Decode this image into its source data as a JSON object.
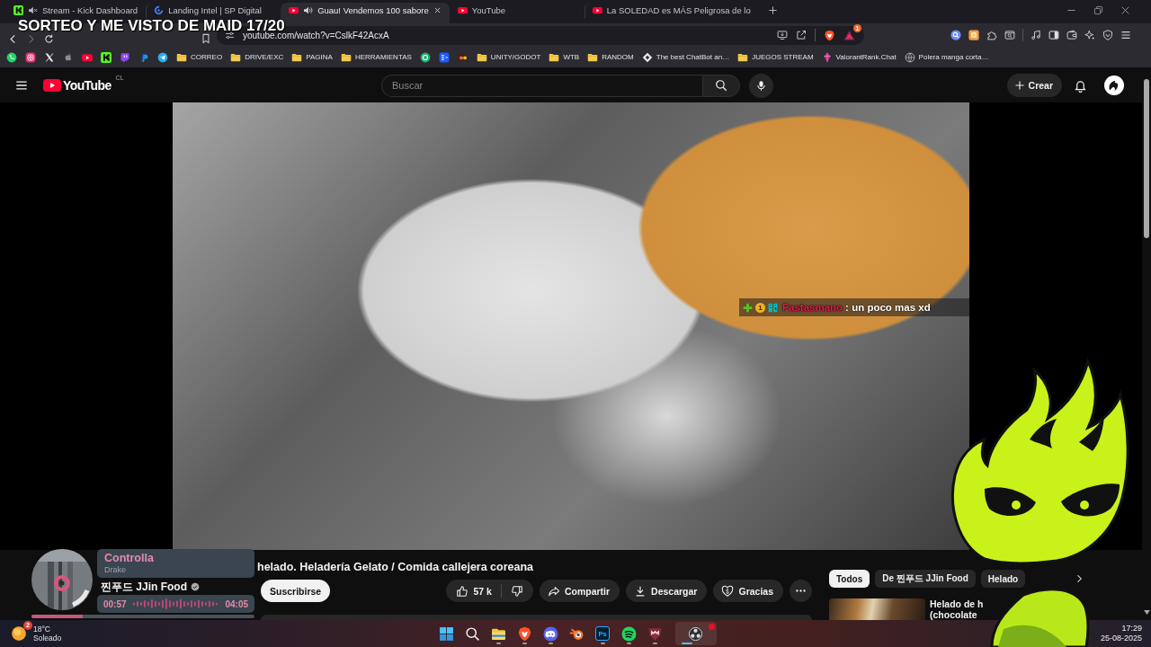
{
  "browser": {
    "tabs": [
      {
        "title": "Stream - Kick Dashboard",
        "selected": false,
        "muted": true,
        "playing": false
      },
      {
        "title": "Landing Intel | SP Digital",
        "selected": false,
        "muted": false,
        "playing": false
      },
      {
        "title": "Guau! Vendemos 100 sabore",
        "selected": true,
        "muted": false,
        "playing": true
      },
      {
        "title": "YouTube",
        "selected": false,
        "muted": false,
        "playing": false
      },
      {
        "title": "La SOLEDAD es MÁS Peligrosa de lo",
        "selected": false,
        "muted": false,
        "playing": false
      }
    ],
    "url": "youtube.com/watch?v=CslkF42AcxA",
    "rewards_badge": "1",
    "bookmarks": [
      {
        "label": "CORREO",
        "kind": "folder"
      },
      {
        "label": "DRIVE/EXC",
        "kind": "folder"
      },
      {
        "label": "PAGINA",
        "kind": "folder"
      },
      {
        "label": "HERRAMIENTAS",
        "kind": "folder"
      },
      {
        "label": "UNITY/GODOT",
        "kind": "folder"
      },
      {
        "label": "WTB",
        "kind": "folder"
      },
      {
        "label": "RANDOM",
        "kind": "folder"
      },
      {
        "label": "The best ChatBot an…",
        "kind": "site"
      },
      {
        "label": "JUEGOS STREAM",
        "kind": "folder"
      },
      {
        "label": "ValorantRank.Chat",
        "kind": "site"
      },
      {
        "label": "Polera manga corta…",
        "kind": "site"
      }
    ]
  },
  "stream_overlay": {
    "headline": "SORTEO Y ME VISTO DE MAID 17/20",
    "chat": {
      "badge": "1",
      "user": "Fastasmano",
      "message": ": un poco mas xd"
    }
  },
  "youtube": {
    "logo": "YouTube",
    "region": "CL",
    "search": {
      "placeholder": "Buscar"
    },
    "create": "Crear",
    "video": {
      "title": "helado. Heladería Gelato / Comida callejera coreana",
      "channel": "찐푸드 JJin Food",
      "subscribe": "Suscribirse",
      "likes": "57 k",
      "actions": [
        "Compartir",
        "Descargar",
        "Gracias"
      ]
    },
    "chips": [
      {
        "label": "Todos",
        "selected": true
      },
      {
        "label": "De 찐푸드 JJin Food",
        "selected": false
      },
      {
        "label": "Helado",
        "selected": false
      }
    ],
    "recommended": {
      "title": "Helado de h (chocolate"
    }
  },
  "music_player": {
    "song": "Controlla",
    "artist": "Drake",
    "elapsed": "00:57",
    "duration": "04:05",
    "level": 0.23
  },
  "taskbar": {
    "weather": {
      "badge": "2",
      "temperature": "18°C",
      "condition": "Soleado"
    },
    "apps": [
      {
        "running": false,
        "active": false,
        "alert": false
      },
      {
        "running": false,
        "active": false,
        "alert": false
      },
      {
        "running": true,
        "active": false,
        "alert": false
      },
      {
        "running": true,
        "active": false,
        "alert": false
      },
      {
        "running": true,
        "active": false,
        "alert": false
      },
      {
        "running": false,
        "active": false,
        "alert": false
      },
      {
        "running": true,
        "active": false,
        "alert": false,
        "label": "Ps"
      },
      {
        "running": true,
        "active": false,
        "alert": false
      },
      {
        "running": true,
        "active": false,
        "alert": false
      },
      {
        "running": true,
        "active": true,
        "alert": true
      }
    ],
    "time": "17:29",
    "date": "25-08-2025"
  }
}
